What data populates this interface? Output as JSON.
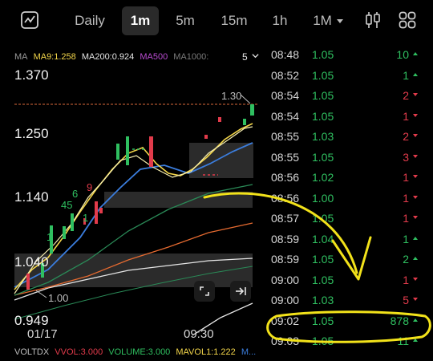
{
  "toolbar": {
    "chart_icon": "line-chart-icon",
    "timeframes": [
      "Daily",
      "1m",
      "5m",
      "15m",
      "1h",
      "1M"
    ],
    "active_timeframe": "1m",
    "candle_icon": "candlestick-icon",
    "grid_icon": "grid-icon"
  },
  "chart": {
    "ma_legend": [
      {
        "text": "MA",
        "color": "#9a9a9a"
      },
      {
        "text": "MA9:1.258",
        "color": "#f2d54a"
      },
      {
        "text": "MA200:0.924",
        "color": "#e6e6e6"
      },
      {
        "text": "MA500",
        "color": "#b84bd0"
      },
      {
        "text": "MA1000:",
        "color": "#7a7a7a"
      }
    ],
    "ma_count": "5",
    "y_labels": [
      "1.370",
      "1.250",
      "1.140",
      "1.040",
      "0.949"
    ],
    "x_labels": [
      "01/17",
      "09:30"
    ],
    "price_tag": "1.30",
    "low_tag": "1.00",
    "level_numbers": [
      "9",
      "6",
      "45",
      "1",
      "1"
    ],
    "vol_legend": [
      {
        "text": "VOLTDX",
        "color": "#bdbdbd"
      },
      {
        "text": "VVOL:3.000",
        "color": "#e23b4b"
      },
      {
        "text": "VOLUME:3.000",
        "color": "#2fbf60"
      },
      {
        "text": "MAVOL1:1.222",
        "color": "#f2d54a"
      },
      {
        "text": "M...",
        "color": "#3b7ddd"
      }
    ]
  },
  "trades": [
    {
      "time": "08:48",
      "price": "1.05",
      "qty": "10",
      "side": "buy"
    },
    {
      "time": "08:52",
      "price": "1.05",
      "qty": "1",
      "side": "buy"
    },
    {
      "time": "08:54",
      "price": "1.05",
      "qty": "2",
      "side": "sell"
    },
    {
      "time": "08:54",
      "price": "1.05",
      "qty": "1",
      "side": "sell"
    },
    {
      "time": "08:55",
      "price": "1.03",
      "qty": "2",
      "side": "sell"
    },
    {
      "time": "08:55",
      "price": "1.05",
      "qty": "3",
      "side": "sell"
    },
    {
      "time": "08:56",
      "price": "1.02",
      "qty": "1",
      "side": "sell"
    },
    {
      "time": "08:56",
      "price": "1.00",
      "qty": "1",
      "side": "sell"
    },
    {
      "time": "08:57",
      "price": "1.05",
      "qty": "1",
      "side": "sell"
    },
    {
      "time": "08:59",
      "price": "1.04",
      "qty": "1",
      "side": "buy"
    },
    {
      "time": "08:59",
      "price": "1.05",
      "qty": "2",
      "side": "buy"
    },
    {
      "time": "09:00",
      "price": "1.05",
      "qty": "1",
      "side": "sell"
    },
    {
      "time": "09:00",
      "price": "1.03",
      "qty": "5",
      "side": "sell"
    },
    {
      "time": "09:02",
      "price": "1.05",
      "qty": "878",
      "side": "buy"
    },
    {
      "time": "09:03",
      "price": "1.05",
      "qty": "11",
      "side": "buy"
    }
  ],
  "colors": {
    "buy": "#2fbf60",
    "sell": "#e23b4b",
    "annotation": "#f2e21a",
    "accent_blue": "#3b7ddd"
  }
}
